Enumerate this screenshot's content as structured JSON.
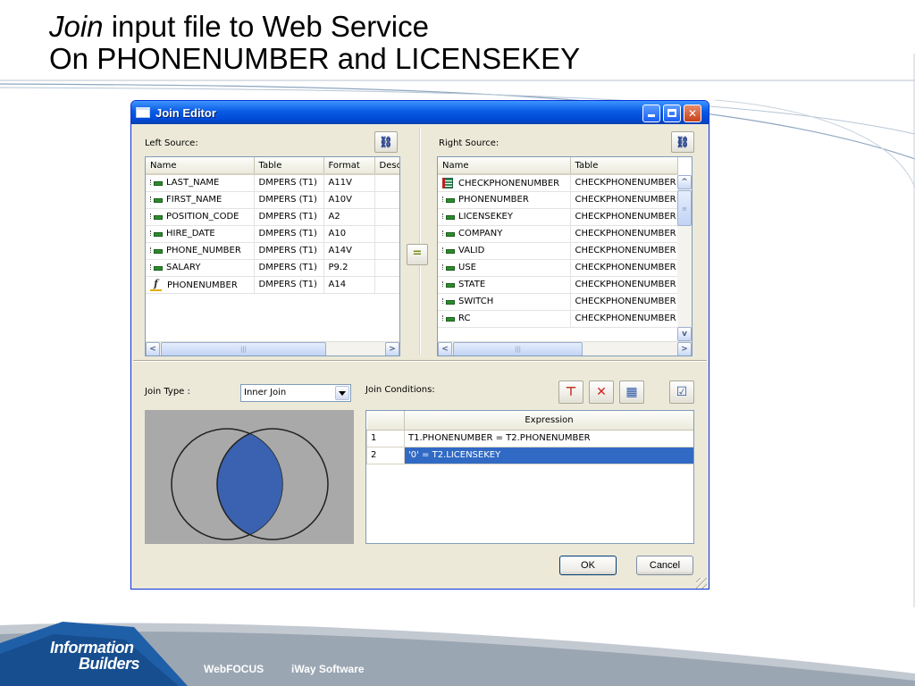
{
  "slide": {
    "title_em": "Join",
    "title_rest": " input file to Web Service",
    "title_line2": "On PHONENUMBER and LICENSEKEY"
  },
  "window": {
    "title": "Join Editor",
    "left_source_label": "Left Source:",
    "right_source_label": "Right Source:",
    "left_columns": [
      "Name",
      "Table",
      "Format",
      "Desc"
    ],
    "left_rows": [
      {
        "icon": "field-icon",
        "name": "LAST_NAME",
        "table": "DMPERS (T1)",
        "format": "A11V"
      },
      {
        "icon": "field-icon",
        "name": "FIRST_NAME",
        "table": "DMPERS (T1)",
        "format": "A10V"
      },
      {
        "icon": "field-icon",
        "name": "POSITION_CODE",
        "table": "DMPERS (T1)",
        "format": "A2"
      },
      {
        "icon": "field-icon",
        "name": "HIRE_DATE",
        "table": "DMPERS (T1)",
        "format": "A10"
      },
      {
        "icon": "field-icon",
        "name": "PHONE_NUMBER",
        "table": "DMPERS (T1)",
        "format": "A14V"
      },
      {
        "icon": "field-icon",
        "name": "SALARY",
        "table": "DMPERS (T1)",
        "format": "P9.2"
      },
      {
        "icon": "computed-field-icon",
        "name": "PHONENUMBER",
        "table": "DMPERS (T1)",
        "format": "A14"
      }
    ],
    "right_columns": [
      "Name",
      "Table"
    ],
    "right_rows": [
      {
        "icon": "table-icon",
        "name": "CHECKPHONENUMBER",
        "table": "CHECKPHONENUMBER"
      },
      {
        "icon": "field-icon",
        "name": "PHONENUMBER",
        "table": "CHECKPHONENUMBER"
      },
      {
        "icon": "field-icon",
        "name": "LICENSEKEY",
        "table": "CHECKPHONENUMBER"
      },
      {
        "icon": "field-icon",
        "name": "COMPANY",
        "table": "CHECKPHONENUMBER"
      },
      {
        "icon": "field-icon",
        "name": "VALID",
        "table": "CHECKPHONENUMBER"
      },
      {
        "icon": "field-icon",
        "name": "USE",
        "table": "CHECKPHONENUMBER"
      },
      {
        "icon": "field-icon",
        "name": "STATE",
        "table": "CHECKPHONENUMBER"
      },
      {
        "icon": "field-icon",
        "name": "SWITCH",
        "table": "CHECKPHONENUMBER"
      },
      {
        "icon": "field-icon",
        "name": "RC",
        "table": "CHECKPHONENUMBER"
      }
    ],
    "join_type_label": "Join Type :",
    "join_type_value": "Inner Join",
    "join_conditions_label": "Join Conditions:",
    "expression_header": "Expression",
    "conditions": [
      {
        "num": "1",
        "expr": "T1.PHONENUMBER = T2.PHONENUMBER",
        "selected": false
      },
      {
        "num": "2",
        "expr": "'0' = T2.LICENSEKEY",
        "selected": true
      }
    ],
    "ok_label": "OK",
    "cancel_label": "Cancel",
    "equals_label": "="
  },
  "footer": {
    "logo_line1": "Information",
    "logo_line2": "Builders",
    "product1": "WebFOCUS",
    "product2": "iWay Software"
  },
  "colors": {
    "selection": "#316ac5",
    "venn_intersection": "#3a62b0",
    "footer_blue": "#1f5fa8"
  }
}
